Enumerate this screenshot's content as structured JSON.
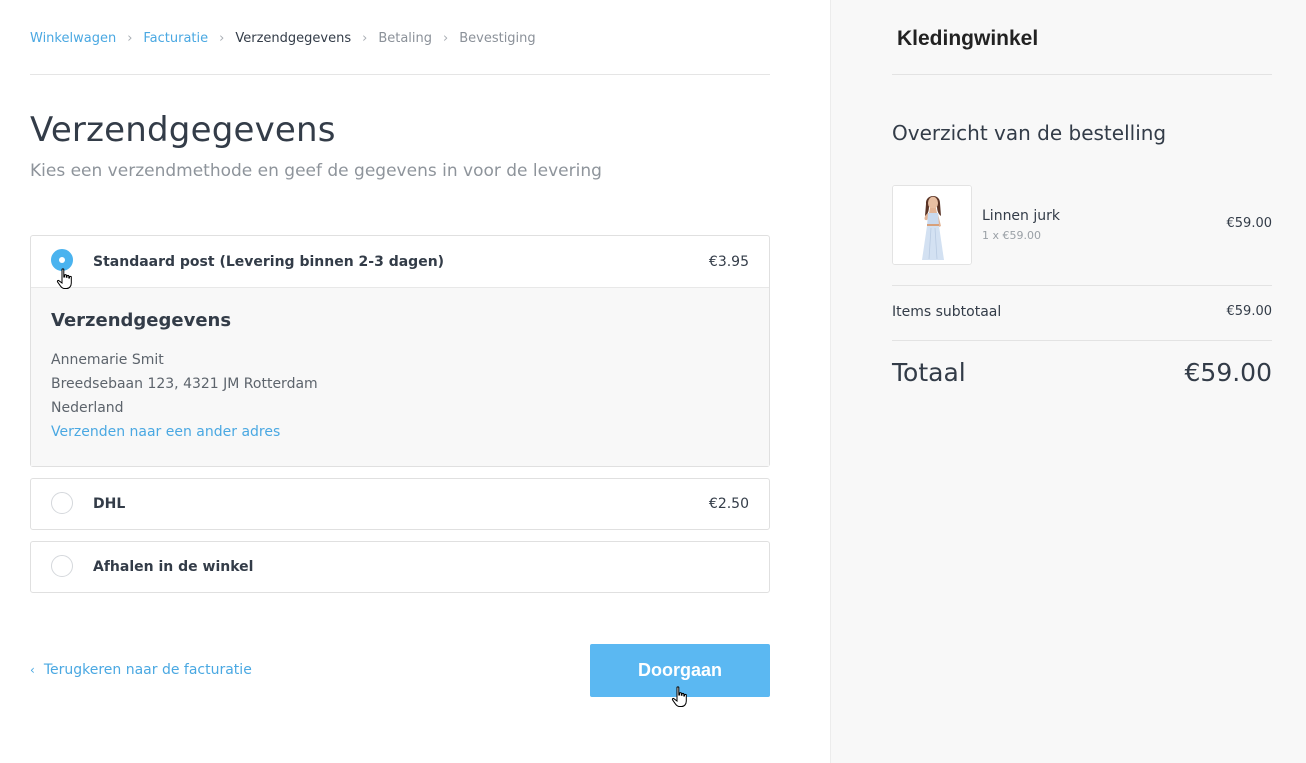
{
  "breadcrumb": {
    "items": [
      {
        "label": "Winkelwagen",
        "state": "done"
      },
      {
        "label": "Facturatie",
        "state": "done"
      },
      {
        "label": "Verzendgegevens",
        "state": "current"
      },
      {
        "label": "Betaling",
        "state": "todo"
      },
      {
        "label": "Bevestiging",
        "state": "todo"
      }
    ],
    "separator": "›"
  },
  "page": {
    "title": "Verzendgegevens",
    "subtitle": "Kies een verzendmethode en geef de gegevens in voor de levering"
  },
  "shipping_options": [
    {
      "label": "Standaard post (Levering binnen 2-3 dagen)",
      "price": "€3.95",
      "selected": true
    },
    {
      "label": "DHL",
      "price": "€2.50",
      "selected": false
    },
    {
      "label": "Afhalen in de winkel",
      "price": "",
      "selected": false
    }
  ],
  "shipping_details": {
    "title": "Verzendgegevens",
    "name": "Annemarie Smit",
    "street": "Breedsebaan 123, 4321 JM Rotterdam",
    "country": "Nederland",
    "change_link": "Verzenden naar een ander adres"
  },
  "footer": {
    "back_label": "Terugkeren naar de facturatie",
    "back_icon": "chevron-left-icon",
    "continue_label": "Doorgaan"
  },
  "aside": {
    "store_name": "Kledingwinkel",
    "summary_title": "Overzicht van de bestelling",
    "product": {
      "name": "Linnen jurk",
      "qty": "1 x €59.00",
      "price": "€59.00"
    },
    "subtotal_label": "Items subtotaal",
    "subtotal_value": "€59.00",
    "total_label": "Totaal",
    "total_value": "€59.00"
  },
  "colors": {
    "accent": "#4ab3ef",
    "link": "#4aa8e2",
    "button": "#5bb8f2",
    "text": "#333c48",
    "muted": "#8e949b"
  }
}
